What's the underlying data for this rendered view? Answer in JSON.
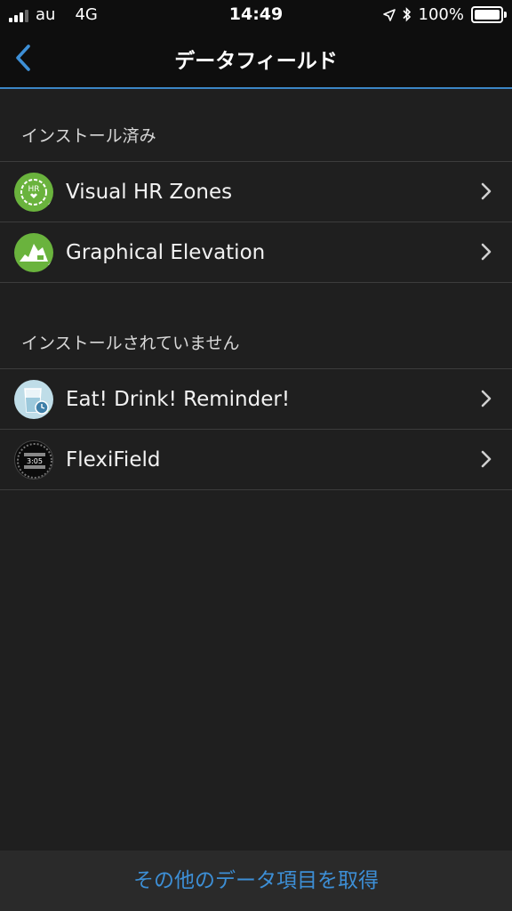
{
  "status_bar": {
    "carrier": "au",
    "network": "4G",
    "time": "14:49",
    "battery": "100%",
    "icons": [
      "signal-icon",
      "location-icon",
      "bluetooth-icon",
      "battery-icon"
    ]
  },
  "nav": {
    "title": "データフィールド",
    "back_icon": "chevron-left-icon",
    "accent_color": "#3b86c6"
  },
  "sections": [
    {
      "header": "インストール済み",
      "items": [
        {
          "label": "Visual HR Zones",
          "icon": "heart-rate-icon"
        },
        {
          "label": "Graphical Elevation",
          "icon": "elevation-icon"
        }
      ]
    },
    {
      "header": "インストールされていません",
      "items": [
        {
          "label": "Eat! Drink! Reminder!",
          "icon": "drink-glass-icon"
        },
        {
          "label": "FlexiField",
          "icon": "watch-face-icon"
        }
      ]
    }
  ],
  "bottom": {
    "link_label": "その他のデータ項目を取得",
    "link_color": "#3d8fd6"
  }
}
